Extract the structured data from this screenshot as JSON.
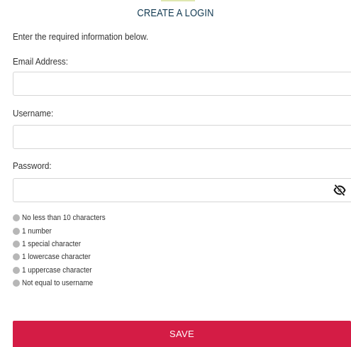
{
  "form": {
    "title": "CREATE A LOGIN",
    "intro": "Enter the required information below.",
    "email": {
      "label": "Email Address:",
      "value": "",
      "placeholder": ""
    },
    "username": {
      "label": "Username:",
      "value": "",
      "placeholder": ""
    },
    "password": {
      "label": "Password:",
      "value": "",
      "placeholder": "",
      "toggle_icon": "eye-slash-icon"
    },
    "requirements": [
      {
        "label": "No less than 10 characters",
        "met": false
      },
      {
        "label": "1 number",
        "met": false
      },
      {
        "label": "1 special character",
        "met": false
      },
      {
        "label": "1 lowercase character",
        "met": false
      },
      {
        "label": "1 uppercase character",
        "met": false
      },
      {
        "label": "Not equal to username",
        "met": false
      }
    ],
    "save_label": "SAVE"
  },
  "colors": {
    "title": "#123a52",
    "save_button": "#d41c45",
    "requirement_dot": "#b7b7b7",
    "field_border": "#d6d6d6"
  }
}
